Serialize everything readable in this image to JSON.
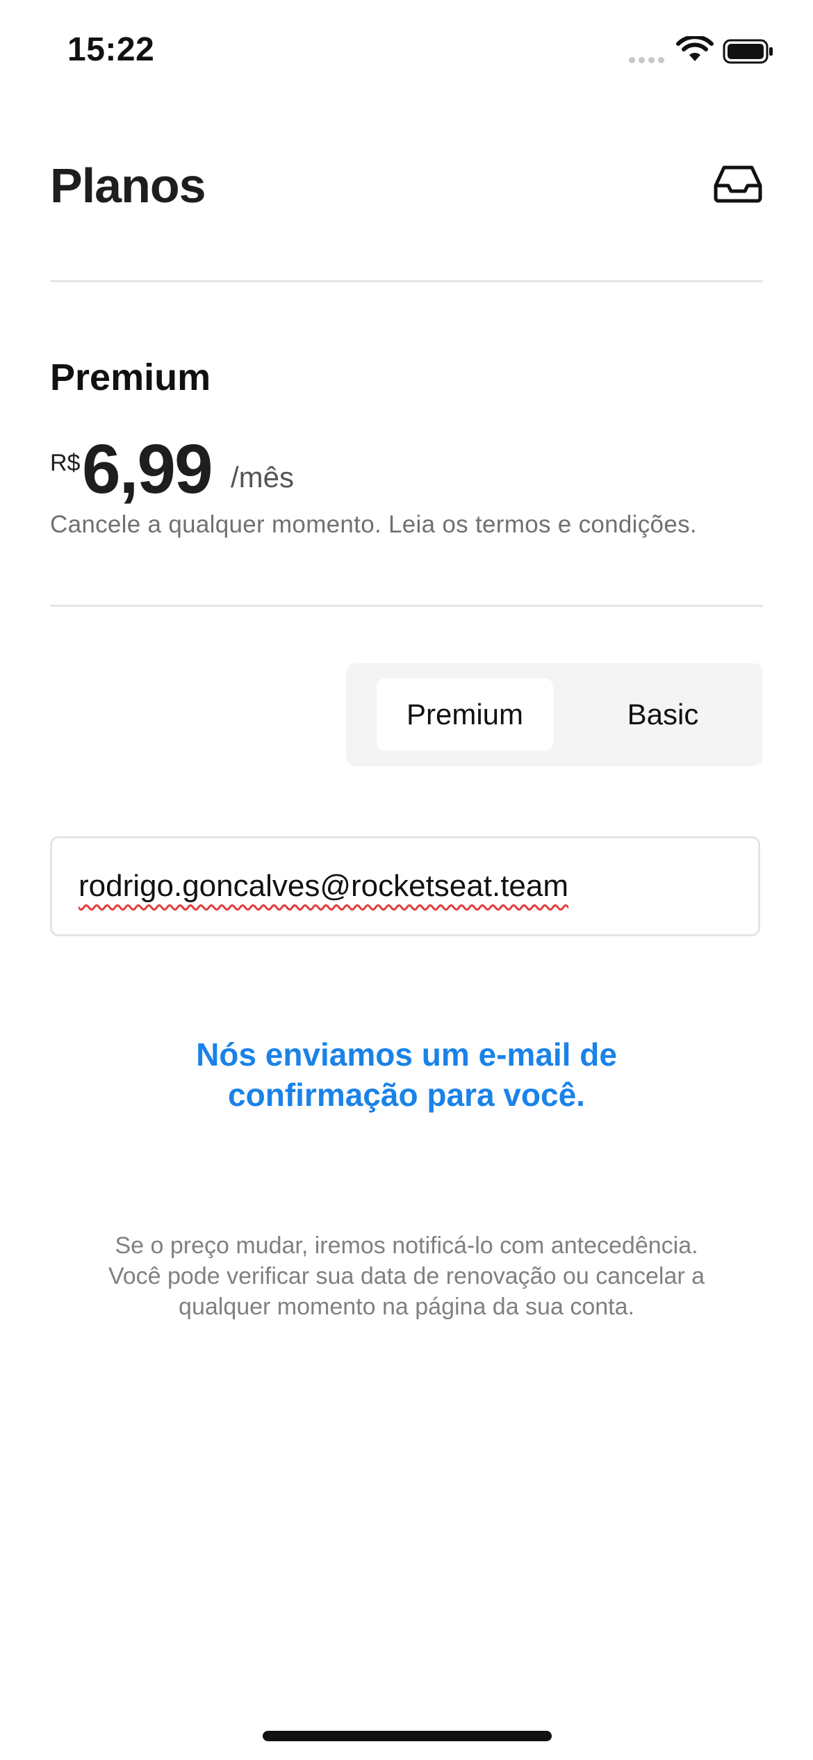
{
  "status_bar": {
    "time": "15:22"
  },
  "header": {
    "title": "Planos",
    "icon": "inbox-icon"
  },
  "plan": {
    "name": "Premium",
    "currency": "R$",
    "amount": "6,99",
    "period": "/mês",
    "terms": "Cancele a qualquer momento. Leia os termos e condições."
  },
  "segmented": {
    "options": [
      "Premium",
      "Basic"
    ],
    "selected": "Premium"
  },
  "email": {
    "value": "rodrigo.goncalves@rocketseat.team"
  },
  "confirmation": {
    "line1": "Nós enviamos um e-mail de",
    "line2": "confirmação para você."
  },
  "footnote": {
    "line1": "Se o preço mudar, iremos notificá-lo com antecedência.",
    "line2": "Você pode verificar sua data de renovação ou cancelar a",
    "line3": "qualquer momento na página da sua conta."
  },
  "colors": {
    "accent": "#1a82e8",
    "divider": "#e5e5e5",
    "segment_bg": "#f4f4f4",
    "spellcheck": "#e23b3b"
  }
}
